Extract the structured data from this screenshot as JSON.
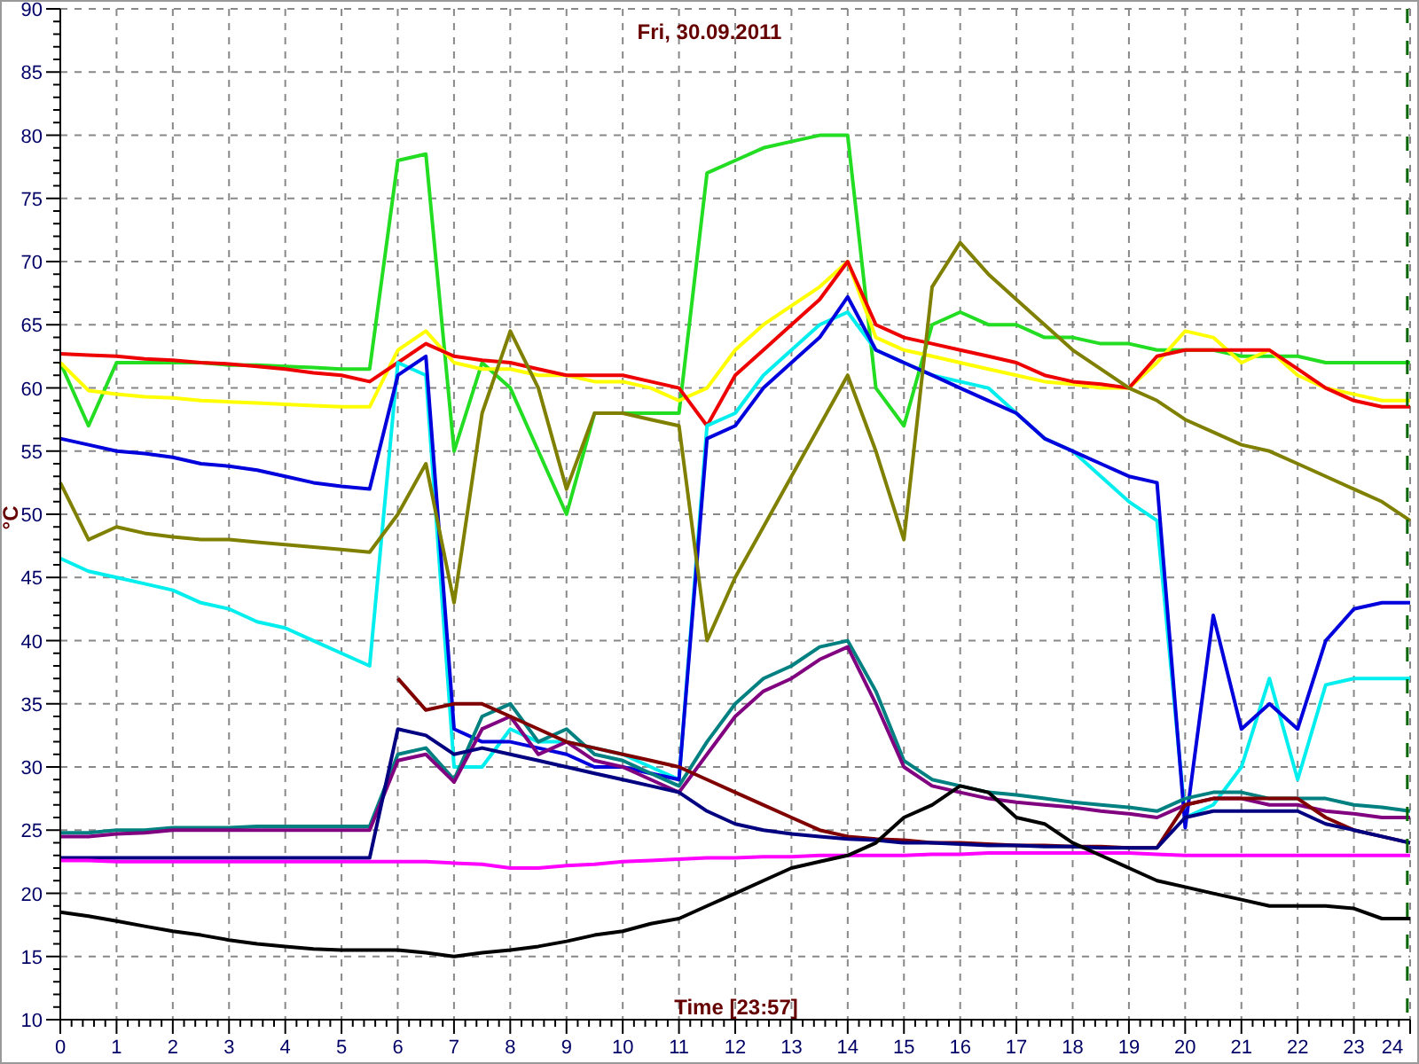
{
  "chart_data": {
    "type": "line",
    "title": "Fri, 30.09.2011",
    "xlabel": "Time [23:57]",
    "ylabel": "°C",
    "x": [
      0,
      0.5,
      1,
      1.5,
      2,
      2.5,
      3,
      3.5,
      4,
      4.5,
      5,
      5.5,
      6,
      6.5,
      7,
      7.5,
      8,
      8.5,
      9,
      9.5,
      10,
      10.5,
      11,
      11.5,
      12,
      12.5,
      13,
      13.5,
      14,
      14.5,
      15,
      15.5,
      16,
      16.5,
      17,
      17.5,
      18,
      18.5,
      19,
      19.5,
      20,
      20.5,
      21,
      21.5,
      22,
      22.5,
      23,
      23.5,
      24
    ],
    "grid": true,
    "xlim": [
      0,
      24
    ],
    "ylim": [
      10,
      90
    ],
    "xticks": [
      0,
      1,
      2,
      3,
      4,
      5,
      6,
      7,
      8,
      9,
      10,
      11,
      12,
      13,
      14,
      15,
      16,
      17,
      18,
      19,
      20,
      21,
      22,
      23,
      24
    ],
    "yticks": [
      10,
      15,
      20,
      25,
      30,
      35,
      40,
      45,
      50,
      55,
      60,
      65,
      70,
      75,
      80,
      85,
      90
    ],
    "series": [
      {
        "color": "#22dd22",
        "values": [
          62,
          57,
          62,
          62,
          62,
          62,
          61.8,
          61.8,
          61.7,
          61.6,
          61.5,
          61.5,
          78,
          78.5,
          55,
          62,
          60,
          55,
          50,
          58,
          58,
          58,
          58,
          77,
          78,
          79,
          79.5,
          80,
          80,
          60,
          57,
          65,
          66,
          65,
          65,
          64,
          64,
          63.5,
          63.5,
          63,
          63,
          63,
          62.5,
          62.5,
          62.5,
          62,
          62,
          62,
          62
        ]
      },
      {
        "color": "#ffff00",
        "values": [
          62,
          59.8,
          59.5,
          59.3,
          59.2,
          59,
          58.9,
          58.8,
          58.7,
          58.6,
          58.5,
          58.5,
          63,
          64.5,
          62,
          61.5,
          61.5,
          61,
          61,
          60.5,
          60.5,
          60,
          59,
          60,
          63,
          65,
          66.5,
          68,
          70,
          64,
          63,
          62.5,
          62,
          61.5,
          61,
          60.5,
          60.3,
          60,
          60,
          62,
          64.5,
          64,
          62,
          63,
          61,
          60,
          59.5,
          59,
          59
        ]
      },
      {
        "color": "#ee0000",
        "values": [
          62.7,
          62.6,
          62.5,
          62.3,
          62.2,
          62,
          61.9,
          61.7,
          61.5,
          61.2,
          61,
          60.5,
          62,
          63.5,
          62.5,
          62.2,
          62,
          61.5,
          61,
          61,
          61,
          60.5,
          60,
          57,
          61,
          63,
          65,
          67,
          70,
          65,
          64,
          63.5,
          63,
          62.5,
          62,
          61,
          60.5,
          60.3,
          60,
          62.5,
          63,
          63,
          63,
          63,
          61.5,
          60,
          59,
          58.5,
          58.5
        ]
      },
      {
        "color": "#00eeee",
        "values": [
          46.5,
          45.5,
          45,
          44.5,
          44,
          43,
          42.5,
          41.5,
          41,
          40,
          39,
          38,
          62,
          61,
          30,
          30,
          33,
          32,
          32,
          31.5,
          31,
          30,
          29,
          57,
          58,
          61,
          63,
          65,
          66,
          63,
          62,
          61,
          60.5,
          60,
          58,
          56,
          55,
          53,
          51,
          49.5,
          26,
          27,
          30,
          37,
          29,
          36.5,
          37,
          37,
          37
        ]
      },
      {
        "color": "#0000dd",
        "values": [
          56,
          55.5,
          55,
          54.8,
          54.5,
          54,
          53.8,
          53.5,
          53,
          52.5,
          52.2,
          52,
          61,
          62.5,
          33,
          32,
          32,
          31.5,
          31,
          30,
          30,
          29.5,
          29,
          56,
          57,
          60,
          62,
          64,
          67.2,
          63,
          62,
          61,
          60,
          59,
          58,
          56,
          55,
          54,
          53,
          52.5,
          25.2,
          42,
          33,
          35,
          33,
          40,
          42.5,
          43,
          43
        ]
      },
      {
        "color": "#808000",
        "values": [
          52.5,
          48,
          49,
          48.5,
          48.2,
          48,
          48,
          47.8,
          47.6,
          47.4,
          47.2,
          47,
          50,
          54,
          43,
          58,
          64.5,
          60,
          52,
          58,
          58,
          57.5,
          57,
          40,
          45,
          49,
          53,
          57,
          61,
          55,
          48,
          68,
          71.5,
          69,
          67,
          65,
          63,
          61.5,
          60,
          59,
          57.5,
          56.5,
          55.5,
          55,
          54,
          53,
          52,
          51,
          49.5
        ]
      },
      {
        "color": "#008080",
        "values": [
          24.8,
          24.8,
          25,
          25,
          25.2,
          25.2,
          25.2,
          25.3,
          25.3,
          25.3,
          25.3,
          25.3,
          31,
          31.5,
          29,
          34,
          35,
          32,
          33,
          31,
          30.5,
          29.5,
          28.5,
          32,
          35,
          37,
          38,
          39.5,
          40,
          36,
          30.5,
          29,
          28.5,
          28,
          27.8,
          27.5,
          27.2,
          27,
          26.8,
          26.5,
          27.5,
          28,
          28,
          27.5,
          27.5,
          27.5,
          27,
          26.8,
          26.5
        ]
      },
      {
        "color": "#800080",
        "values": [
          24.5,
          24.5,
          24.7,
          24.8,
          25,
          25,
          25,
          25,
          25,
          25,
          25,
          25,
          30.5,
          31,
          28.8,
          33,
          34,
          31,
          32,
          30.5,
          30,
          29,
          28,
          31,
          34,
          36,
          37,
          38.5,
          39.5,
          35,
          30,
          28.5,
          28,
          27.5,
          27.2,
          27,
          26.8,
          26.5,
          26.3,
          26,
          27,
          27.5,
          27.5,
          27,
          27,
          26.5,
          26.3,
          26,
          26
        ]
      },
      {
        "color": "#800000",
        "values": [
          null,
          null,
          null,
          null,
          null,
          null,
          null,
          null,
          null,
          null,
          null,
          null,
          37,
          34.5,
          35,
          35,
          34,
          33,
          32,
          31.5,
          31,
          30.5,
          30,
          29,
          28,
          27,
          26,
          25,
          24.5,
          24.3,
          24.2,
          24,
          24,
          23.9,
          23.8,
          23.8,
          23.7,
          23.7,
          23.6,
          23.6,
          27,
          27.5,
          27.5,
          27.5,
          27.5,
          26,
          25,
          24.5,
          24
        ]
      },
      {
        "color": "#000080",
        "values": [
          22.8,
          22.8,
          22.8,
          22.8,
          22.8,
          22.8,
          22.8,
          22.8,
          22.8,
          22.8,
          22.8,
          22.8,
          33,
          32.5,
          31,
          31.5,
          31,
          30.5,
          30,
          29.5,
          29,
          28.5,
          28,
          26.5,
          25.5,
          25,
          24.7,
          24.5,
          24.3,
          24.2,
          24,
          24,
          23.9,
          23.8,
          23.8,
          23.7,
          23.7,
          23.6,
          23.6,
          23.6,
          26,
          26.5,
          26.5,
          26.5,
          26.5,
          25.5,
          25,
          24.5,
          24
        ]
      },
      {
        "color": "#ff00ff",
        "values": [
          22.6,
          22.6,
          22.5,
          22.5,
          22.5,
          22.5,
          22.5,
          22.5,
          22.5,
          22.5,
          22.5,
          22.5,
          22.5,
          22.5,
          22.4,
          22.3,
          22,
          22,
          22.2,
          22.3,
          22.5,
          22.6,
          22.7,
          22.8,
          22.8,
          22.9,
          22.9,
          23,
          23,
          23,
          23,
          23.1,
          23.1,
          23.2,
          23.2,
          23.2,
          23.2,
          23.2,
          23.2,
          23.1,
          23,
          23,
          23,
          23,
          23,
          23,
          23,
          23,
          23
        ]
      },
      {
        "color": "#000000",
        "values": [
          18.5,
          18.2,
          17.8,
          17.4,
          17,
          16.7,
          16.3,
          16,
          15.8,
          15.6,
          15.5,
          15.5,
          15.5,
          15.3,
          15,
          15.3,
          15.5,
          15.8,
          16.2,
          16.7,
          17,
          17.6,
          18,
          19,
          20,
          21,
          22,
          22.5,
          23,
          24,
          26,
          27,
          28.5,
          28,
          26,
          25.5,
          24,
          23,
          22,
          21,
          20.5,
          20,
          19.5,
          19,
          19,
          19,
          18.8,
          18,
          18
        ]
      }
    ]
  }
}
